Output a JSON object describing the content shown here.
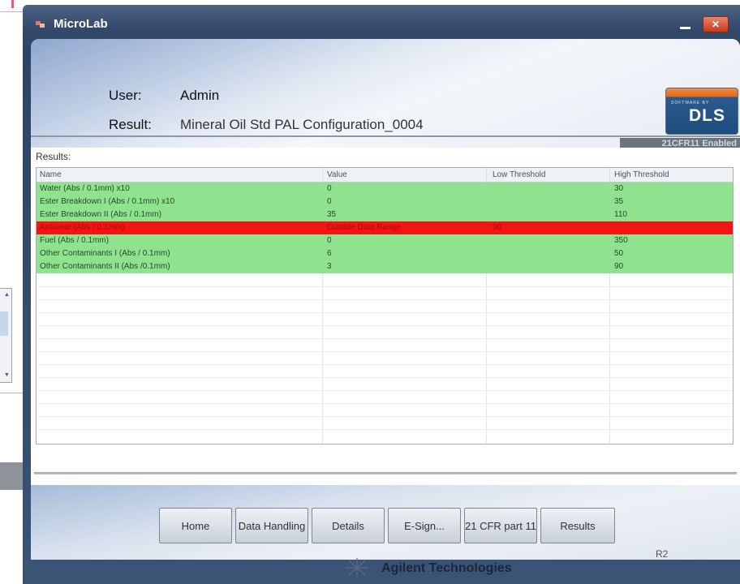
{
  "window": {
    "title": "MicroLab",
    "close_glyph": "✕"
  },
  "header": {
    "user_label": "User:",
    "user_value": "Admin",
    "result_label": "Result:",
    "result_value": "Mineral Oil Std PAL Configuration_0004",
    "badge": "21CFR11 Enabled",
    "logo": {
      "main": "DLS",
      "small": "SOFTWARE BY"
    }
  },
  "results": {
    "label": "Results:",
    "columns": [
      "Name",
      "Value",
      "Low Threshold",
      "High Threshold"
    ],
    "rows": [
      {
        "status": "pass",
        "name": "Water (Abs / 0.1mm) x10",
        "value": "0",
        "low": "",
        "high": "30"
      },
      {
        "status": "pass",
        "name": "Ester Breakdown I (Abs / 0.1mm) x10",
        "value": "0",
        "low": "",
        "high": "35"
      },
      {
        "status": "pass",
        "name": "Ester Breakdown II (Abs / 0.1mm)",
        "value": "35",
        "low": "",
        "high": "110"
      },
      {
        "status": "fail",
        "name": "Antiwear (Abs / 0.1mm)",
        "value": "Outside Data Range",
        "low": "90",
        "high": ""
      },
      {
        "status": "pass",
        "name": "Fuel (Abs / 0.1mm)",
        "value": "0",
        "low": "",
        "high": "350"
      },
      {
        "status": "pass",
        "name": "Other Contaminants I (Abs / 0.1mm)",
        "value": "6",
        "low": "",
        "high": "50"
      },
      {
        "status": "pass",
        "name": "Other Contaminants II (Abs /0.1mm)",
        "value": "3",
        "low": "",
        "high": "90"
      }
    ]
  },
  "toolbar": {
    "home": "Home",
    "data_handling": "Data Handling",
    "details": "Details",
    "esign": "E-Sign...",
    "cfr": "21 CFR part 11",
    "results": "Results",
    "revision": "R2"
  },
  "footer": {
    "brand": "Agilent Technologies"
  },
  "colors": {
    "pass_row": "#8fe38e",
    "fail_row": "#f51414",
    "title_bar": "#33496a"
  }
}
